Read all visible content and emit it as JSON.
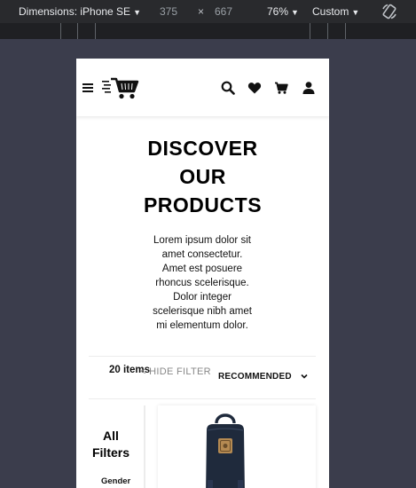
{
  "devtools": {
    "device_label": "Dimensions: iPhone SE",
    "width": "375",
    "times": "×",
    "height": "667",
    "zoom": "76%",
    "throttle": "Custom"
  },
  "site": {
    "hero": {
      "title_lines": [
        "DISCOVER",
        "OUR",
        "PRODUCTS"
      ],
      "description": "Lorem ipsum dolor sit amet consectetur. Amet est posuere rhoncus scelerisque. Dolor integer scelerisque nibh amet mi elementum dolor."
    },
    "listing": {
      "items_count": "20 items",
      "hide_filter": "< HIDE FILTER",
      "sort_label": "RECOMMENDED"
    },
    "filters": {
      "title_lines": [
        "All",
        "Filters"
      ],
      "gender_label": "Gender"
    }
  },
  "colors": {
    "devtools_bar": "#292a2d",
    "canvas_bg": "#3b3d4c",
    "text_primary": "#000000",
    "text_muted": "#888888",
    "backpack": "#1f2a3c"
  }
}
